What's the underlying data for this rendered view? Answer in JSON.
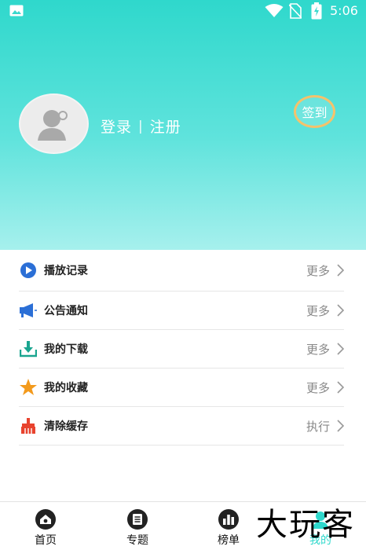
{
  "status_bar": {
    "time": "5:06"
  },
  "profile": {
    "login_label": "登录",
    "separator": "|",
    "register_label": "注册",
    "signin_label": "签到"
  },
  "menu": {
    "items": [
      {
        "label": "播放记录",
        "action": "更多",
        "icon": "play-icon"
      },
      {
        "label": "公告通知",
        "action": "更多",
        "icon": "megaphone-icon"
      },
      {
        "label": "我的下载",
        "action": "更多",
        "icon": "download-icon"
      },
      {
        "label": "我的收藏",
        "action": "更多",
        "icon": "star-icon"
      },
      {
        "label": "清除缓存",
        "action": "执行",
        "icon": "broom-icon"
      }
    ]
  },
  "bottom_nav": {
    "items": [
      {
        "label": "首页",
        "icon": "home-icon"
      },
      {
        "label": "专题",
        "icon": "topic-icon"
      },
      {
        "label": "榜单",
        "icon": "chart-icon"
      },
      {
        "label": "我的",
        "icon": "profile-icon"
      }
    ]
  },
  "watermark": "大玩客",
  "colors": {
    "header_top": "#2fd8cc",
    "header_bottom": "#a6f0ed",
    "signin_ring": "#f5c26b",
    "play_blue": "#2b6fd6",
    "download_green": "#1aa58f",
    "star_orange": "#f39a1c",
    "broom_red": "#e8432e",
    "active_tab": "#2fd8cc"
  }
}
